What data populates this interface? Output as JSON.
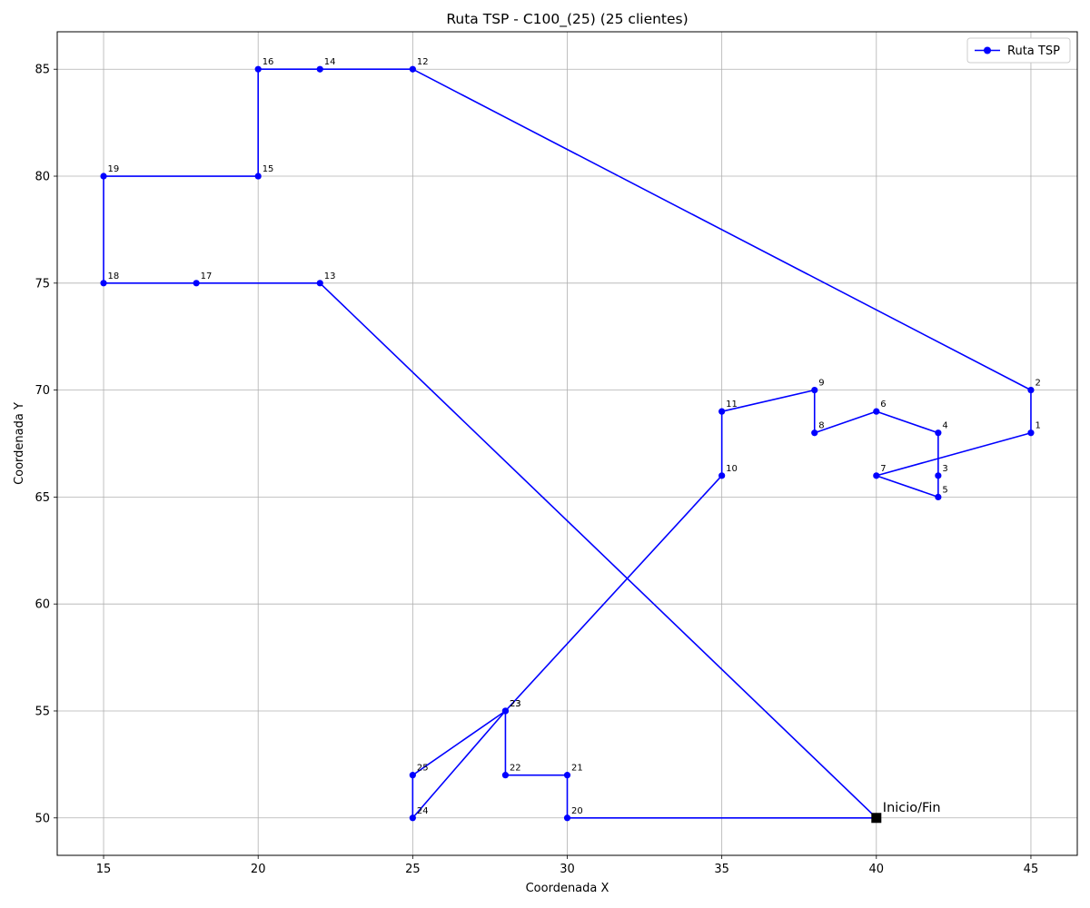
{
  "chart_data": {
    "type": "line",
    "title": "Ruta TSP - C100_(25) (25 clientes)",
    "xlabel": "Coordenada X",
    "ylabel": "Coordenada Y",
    "xlim": [
      13.5,
      46.5
    ],
    "ylim": [
      48.25,
      86.75
    ],
    "xticks": [
      15,
      20,
      25,
      30,
      35,
      40,
      45
    ],
    "yticks": [
      50,
      55,
      60,
      65,
      70,
      75,
      80,
      85
    ],
    "grid": true,
    "legend_position": "top-right",
    "colors": {
      "route": "#0000ff",
      "depot": "#000000",
      "grid": "#b0b0b0"
    },
    "series": [
      {
        "name": "Ruta TSP",
        "route": [
          {
            "label": "",
            "x": 40,
            "y": 50
          },
          {
            "label": "13",
            "x": 22,
            "y": 75
          },
          {
            "label": "17",
            "x": 18,
            "y": 75
          },
          {
            "label": "18",
            "x": 15,
            "y": 75
          },
          {
            "label": "19",
            "x": 15,
            "y": 80
          },
          {
            "label": "15",
            "x": 20,
            "y": 80
          },
          {
            "label": "16",
            "x": 20,
            "y": 85
          },
          {
            "label": "14",
            "x": 22,
            "y": 85
          },
          {
            "label": "12",
            "x": 25,
            "y": 85
          },
          {
            "label": "2",
            "x": 45,
            "y": 70
          },
          {
            "label": "1",
            "x": 45,
            "y": 68
          },
          {
            "label": "7",
            "x": 40,
            "y": 66
          },
          {
            "label": "5",
            "x": 42,
            "y": 65
          },
          {
            "label": "3",
            "x": 42,
            "y": 66
          },
          {
            "label": "4",
            "x": 42,
            "y": 68
          },
          {
            "label": "6",
            "x": 40,
            "y": 69
          },
          {
            "label": "8",
            "x": 38,
            "y": 68
          },
          {
            "label": "9",
            "x": 38,
            "y": 70
          },
          {
            "label": "11",
            "x": 35,
            "y": 69
          },
          {
            "label": "10",
            "x": 35,
            "y": 66
          },
          {
            "label": "23",
            "x": 28,
            "y": 55
          },
          {
            "label": "24",
            "x": 25,
            "y": 50
          },
          {
            "label": "25",
            "x": 25,
            "y": 52
          },
          {
            "label": "23",
            "x": 28,
            "y": 55
          },
          {
            "label": "22",
            "x": 28,
            "y": 52
          },
          {
            "label": "21",
            "x": 30,
            "y": 52
          },
          {
            "label": "20",
            "x": 30,
            "y": 50
          },
          {
            "label": "",
            "x": 40,
            "y": 50
          }
        ]
      }
    ],
    "depot": {
      "label": "Inicio/Fin",
      "x": 40,
      "y": 50
    }
  }
}
